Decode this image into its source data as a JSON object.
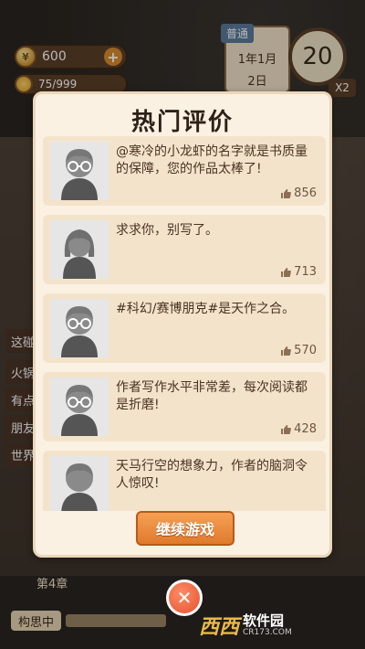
{
  "hud": {
    "coins": "600",
    "energy": "75/999",
    "difficulty_tag": "普通",
    "date_month": "1年1月",
    "date_day": "2日",
    "day_counter": "20",
    "speed": "X2",
    "chapter": "第4章",
    "think_label": "构思中"
  },
  "left_tabs": [
    "这碰",
    "火锅",
    "有点",
    "朋友",
    "世界"
  ],
  "modal": {
    "title": "热门评价",
    "continue_label": "继续游戏",
    "reviews": [
      {
        "text": "@寒冷的小龙虾的名字就是书质量的保障，您的作品太棒了!",
        "likes": "856",
        "avatar": "glasses"
      },
      {
        "text": "求求你，别写了。",
        "likes": "713",
        "avatar": "long-hair"
      },
      {
        "text": "#科幻/赛博朋克#是天作之合。",
        "likes": "570",
        "avatar": "glasses"
      },
      {
        "text": "作者写作水平非常差，每次阅读都是折磨!",
        "likes": "428",
        "avatar": "glasses"
      },
      {
        "text": "天马行空的想象力，作者的脑洞令人惊叹!",
        "likes": "",
        "avatar": "glasses"
      }
    ]
  },
  "watermark": {
    "logo": "西西",
    "name": "软件园",
    "url": "CR173.COM"
  },
  "colors": {
    "accent": "#e07a2c",
    "panel": "#fbf1e2",
    "card": "#f4e3cb"
  }
}
